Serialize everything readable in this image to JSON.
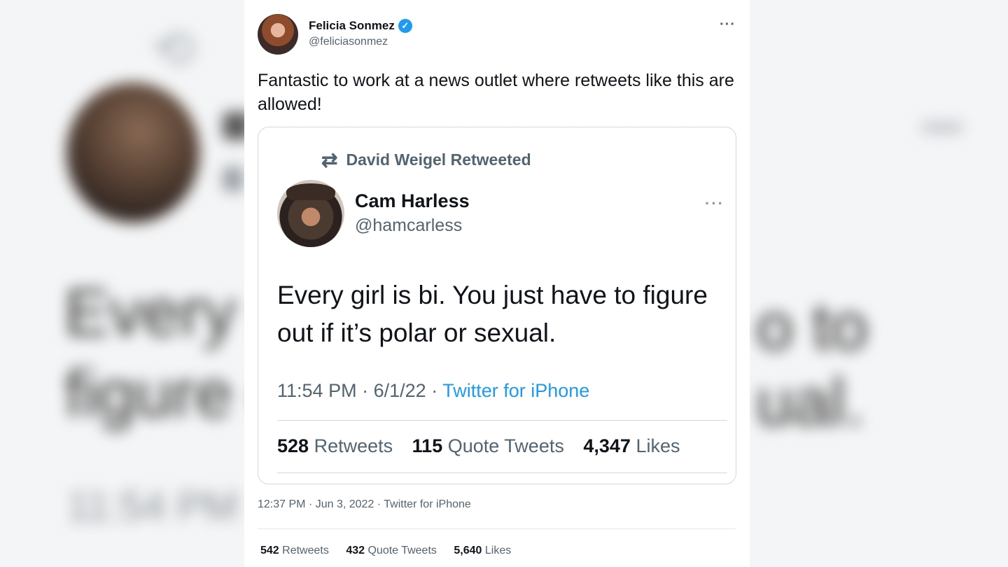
{
  "background": {
    "text_line1": "Every g",
    "text_line2": "figure o",
    "right_line1": "o to",
    "right_line2": "ual.",
    "time_fragment": "11:54 PM"
  },
  "tweet": {
    "author_name": "Felicia Sonmez",
    "author_handle": "@feliciasonmez",
    "verified_icon": "verified-badge-icon",
    "more_icon": "···",
    "text": "Fantastic to work at a news outlet where retweets like this are allowed!",
    "time": "12:37 PM",
    "date": "Jun 3, 2022",
    "source": "Twitter for iPhone",
    "stats": {
      "retweets_count": "542",
      "retweets_label": "Retweets",
      "quotes_count": "432",
      "quotes_label": "Quote Tweets",
      "likes_count": "5,640",
      "likes_label": "Likes"
    }
  },
  "quoted": {
    "retweeted_by": "David Weigel Retweeted",
    "author_name": "Cam Harless",
    "author_handle": "@hamcarless",
    "more_icon": "···",
    "text": "Every girl is bi. You just have to figure out if it’s polar or sexual.",
    "time": "11:54 PM",
    "date": "6/1/22",
    "source": "Twitter for iPhone",
    "stats": {
      "retweets_count": "528",
      "retweets_label": "Retweets",
      "quotes_count": "115",
      "quotes_label": "Quote Tweets",
      "likes_count": "4,347",
      "likes_label": "Likes"
    }
  },
  "colors": {
    "accent": "#1d9bf0",
    "text_primary": "#0f1419",
    "text_secondary": "#536471",
    "border": "#cfd9de"
  }
}
